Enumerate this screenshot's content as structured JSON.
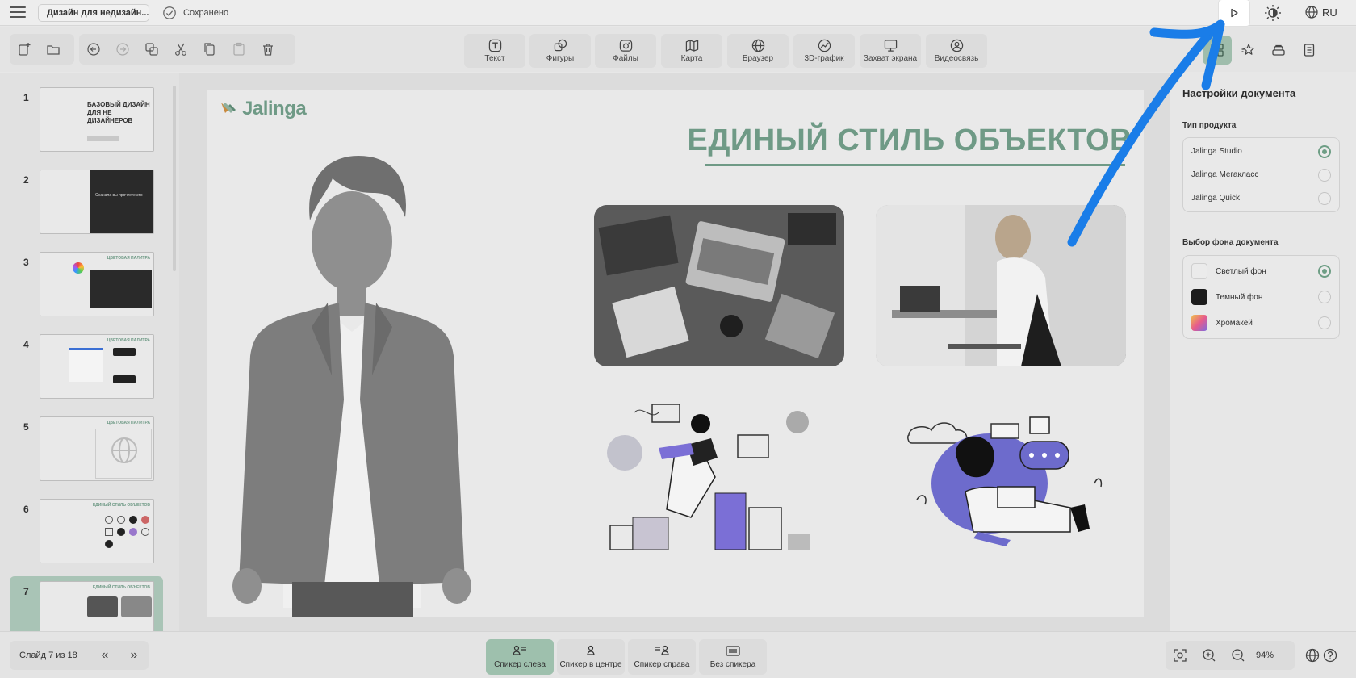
{
  "topbar": {
    "document_title": "Дизайн для недизайн...",
    "saved_status": "Сохранено",
    "language": "RU"
  },
  "toolbar": {
    "tools": [
      {
        "label": "Текст",
        "icon": "text-icon"
      },
      {
        "label": "Фигуры",
        "icon": "shapes-icon"
      },
      {
        "label": "Файлы",
        "icon": "files-icon"
      },
      {
        "label": "Карта",
        "icon": "map-icon"
      },
      {
        "label": "Браузер",
        "icon": "browser-icon"
      },
      {
        "label": "3D-график",
        "icon": "chart-3d-icon"
      },
      {
        "label": "Захват экрана",
        "icon": "screen-capture-icon"
      },
      {
        "label": "Видеосвязь",
        "icon": "video-call-icon"
      }
    ]
  },
  "slides_panel": {
    "slides": [
      {
        "number": "1",
        "thumb_text": "БАЗОВЫЙ ДИЗАЙН ДЛЯ НЕ ДИЗАЙНЕРОВ"
      },
      {
        "number": "2",
        "thumb_text": "Сначала вы прочтете это"
      },
      {
        "number": "3",
        "thumb_text": "ЦВЕТОВАЯ ПАЛИТРА"
      },
      {
        "number": "4",
        "thumb_text": "ЦВЕТОВАЯ ПАЛИТРА"
      },
      {
        "number": "5",
        "thumb_text": "ЦВЕТОВАЯ ПАЛИТРА"
      },
      {
        "number": "6",
        "thumb_text": "ЕДИНЫЙ СТИЛЬ ОБЪЕКТОВ"
      },
      {
        "number": "7",
        "thumb_text": "ЕДИНЫЙ СТИЛЬ ОБЪЕКТОВ"
      }
    ],
    "active_slide": 7
  },
  "slide": {
    "logo_text": "Jalinga",
    "title": "ЕДИНЫЙ СТИЛЬ ОБЪЕКТОВ"
  },
  "settings": {
    "title": "Настройки документа",
    "product_type_label": "Тип продукта",
    "product_types": [
      {
        "label": "Jalinga Studio",
        "selected": true
      },
      {
        "label": "Jalinga Мегакласс",
        "selected": false
      },
      {
        "label": "Jalinga Quick",
        "selected": false
      }
    ],
    "background_label": "Выбор фона документа",
    "backgrounds": [
      {
        "label": "Светлый фон",
        "selected": true,
        "color": "#ebebeb"
      },
      {
        "label": "Темный фон",
        "selected": false,
        "color": "#1c1c1c"
      },
      {
        "label": "Хромакей",
        "selected": false,
        "color": "gradient"
      }
    ]
  },
  "bottombar": {
    "slide_counter": "Слайд 7 из 18",
    "prev_symbol": "«",
    "next_symbol": "»",
    "speaker_modes": [
      {
        "label": "Спикер слева",
        "active": true
      },
      {
        "label": "Спикер в центре",
        "active": false
      },
      {
        "label": "Спикер справа",
        "active": false
      },
      {
        "label": "Без спикера",
        "active": false
      }
    ],
    "zoom": "94%"
  },
  "colors": {
    "accent_green": "#6f9a86",
    "active_speaker_bg": "#9ec0ad",
    "annotation_arrow": "#1a7de8"
  }
}
